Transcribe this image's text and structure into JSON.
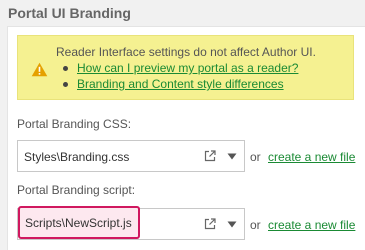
{
  "section": {
    "title": "Portal UI Branding"
  },
  "notice": {
    "icon": "warning-icon",
    "icon_color": "#e5a000",
    "background": "#f5f191",
    "text": "Reader Interface settings do not affect Author UI.",
    "links": [
      "How can I preview my portal as a reader?",
      "Branding and Content style differences"
    ]
  },
  "css_field": {
    "label": "Portal Branding CSS:",
    "value": "Styles\\Branding.css",
    "open_icon": "external-link-icon",
    "dropdown_icon": "chevron-down-icon",
    "or_text": "or",
    "create_link": "create a new file"
  },
  "script_field": {
    "label": "Portal Branding script:",
    "value": "Scripts\\NewScript.js",
    "highlight_color": "#d0185f",
    "open_icon": "external-link-icon",
    "dropdown_icon": "chevron-down-icon",
    "or_text": "or",
    "create_link": "create a new file"
  },
  "link_color": "#1a8a34"
}
